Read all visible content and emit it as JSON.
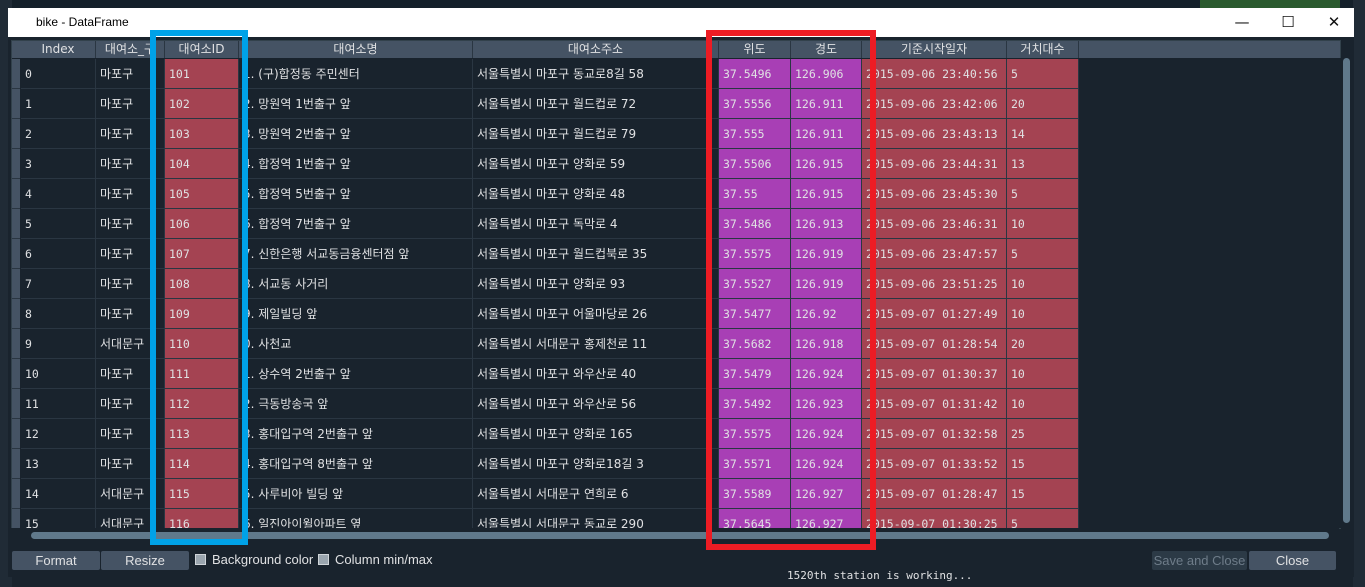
{
  "window": {
    "title": "bike - DataFrame"
  },
  "columns": [
    "Index",
    "대여소_구",
    "대여소ID",
    "대여소명",
    "대여소주소",
    "위도",
    "경도",
    "기준시작일자",
    "거치대수"
  ],
  "rows": [
    {
      "index": "0",
      "gu": "마포구",
      "id": "101",
      "name": "1. (구)합정동 주민센터",
      "addr": "서울특별시 마포구 동교로8길 58",
      "lat": "37.5496",
      "lon": "126.906",
      "date": "2015-09-06 23:40:56",
      "racks": "5"
    },
    {
      "index": "1",
      "gu": "마포구",
      "id": "102",
      "name": "2. 망원역 1번출구 앞",
      "addr": "서울특별시 마포구 월드컵로 72",
      "lat": "37.5556",
      "lon": "126.911",
      "date": "2015-09-06 23:42:06",
      "racks": "20"
    },
    {
      "index": "2",
      "gu": "마포구",
      "id": "103",
      "name": "3. 망원역 2번출구 앞",
      "addr": "서울특별시 마포구 월드컵로 79",
      "lat": "37.555",
      "lon": "126.911",
      "date": "2015-09-06 23:43:13",
      "racks": "14"
    },
    {
      "index": "3",
      "gu": "마포구",
      "id": "104",
      "name": "4. 합정역 1번출구 앞",
      "addr": "서울특별시 마포구 양화로 59",
      "lat": "37.5506",
      "lon": "126.915",
      "date": "2015-09-06 23:44:31",
      "racks": "13"
    },
    {
      "index": "4",
      "gu": "마포구",
      "id": "105",
      "name": "5. 합정역 5번출구 앞",
      "addr": "서울특별시 마포구 양화로 48",
      "lat": "37.55",
      "lon": "126.915",
      "date": "2015-09-06 23:45:30",
      "racks": "5"
    },
    {
      "index": "5",
      "gu": "마포구",
      "id": "106",
      "name": "6. 합정역 7번출구 앞",
      "addr": "서울특별시 마포구 독막로 4",
      "lat": "37.5486",
      "lon": "126.913",
      "date": "2015-09-06 23:46:31",
      "racks": "10"
    },
    {
      "index": "6",
      "gu": "마포구",
      "id": "107",
      "name": "7. 신한은행 서교동금융센터점 앞",
      "addr": "서울특별시 마포구 월드컵북로 35",
      "lat": "37.5575",
      "lon": "126.919",
      "date": "2015-09-06 23:47:57",
      "racks": "5"
    },
    {
      "index": "7",
      "gu": "마포구",
      "id": "108",
      "name": "8. 서교동 사거리",
      "addr": "서울특별시 마포구 양화로 93",
      "lat": "37.5527",
      "lon": "126.919",
      "date": "2015-09-06 23:51:25",
      "racks": "10"
    },
    {
      "index": "8",
      "gu": "마포구",
      "id": "109",
      "name": "9. 제일빌딩 앞",
      "addr": "서울특별시 마포구 어울마당로 26",
      "lat": "37.5477",
      "lon": "126.92",
      "date": "2015-09-07 01:27:49",
      "racks": "10"
    },
    {
      "index": "9",
      "gu": "서대문구",
      "id": "110",
      "name": "0. 사천교",
      "addr": "서울특별시 서대문구 홍제천로 11",
      "lat": "37.5682",
      "lon": "126.918",
      "date": "2015-09-07 01:28:54",
      "racks": "20"
    },
    {
      "index": "10",
      "gu": "마포구",
      "id": "111",
      "name": "1. 상수역 2번출구 앞",
      "addr": "서울특별시 마포구 와우산로 40",
      "lat": "37.5479",
      "lon": "126.924",
      "date": "2015-09-07 01:30:37",
      "racks": "10"
    },
    {
      "index": "11",
      "gu": "마포구",
      "id": "112",
      "name": "2. 극동방송국 앞",
      "addr": "서울특별시 마포구 와우산로 56",
      "lat": "37.5492",
      "lon": "126.923",
      "date": "2015-09-07 01:31:42",
      "racks": "10"
    },
    {
      "index": "12",
      "gu": "마포구",
      "id": "113",
      "name": "3. 홍대입구역 2번출구 앞",
      "addr": "서울특별시 마포구 양화로 165",
      "lat": "37.5575",
      "lon": "126.924",
      "date": "2015-09-07 01:32:58",
      "racks": "25"
    },
    {
      "index": "13",
      "gu": "마포구",
      "id": "114",
      "name": "4. 홍대입구역 8번출구 앞",
      "addr": "서울특별시 마포구 양화로18길 3",
      "lat": "37.5571",
      "lon": "126.924",
      "date": "2015-09-07 01:33:52",
      "racks": "15"
    },
    {
      "index": "14",
      "gu": "서대문구",
      "id": "115",
      "name": "5. 사루비아 빌딩 앞",
      "addr": "서울특별시 서대문구 연희로 6",
      "lat": "37.5589",
      "lon": "126.927",
      "date": "2015-09-07 01:28:47",
      "racks": "15"
    },
    {
      "index": "15",
      "gu": "서대문구",
      "id": "116",
      "name": "6. 일진아이윌아파트 옆",
      "addr": "서울특별시 서대문구 동교로 290",
      "lat": "37.5645",
      "lon": "126.927",
      "date": "2015-09-07 01:30:25",
      "racks": "5"
    }
  ],
  "bottom": {
    "format_label": "Format",
    "resize_label": "Resize",
    "bg_color_label": "Background color",
    "col_minmax_label": "Column min/max",
    "save_close_label": "Save and Close",
    "close_label": "Close"
  },
  "console_text": "1520th station is working...",
  "colors": {
    "highlight_blue": "#00a2e8",
    "highlight_red": "#ed1c24",
    "cell_red": "#a44352",
    "cell_purple": "#a83fb5"
  }
}
